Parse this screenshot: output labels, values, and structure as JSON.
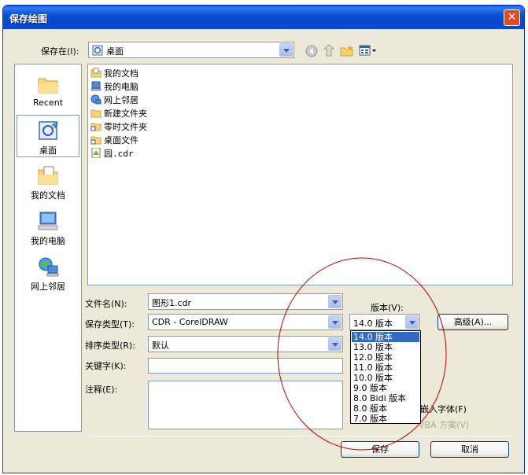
{
  "window": {
    "title": "保存绘图",
    "close_label": "✕"
  },
  "save_in": {
    "label": "保存在(I):",
    "value": "桌面"
  },
  "places": [
    {
      "label": "Recent",
      "icon": "recent-folder-icon"
    },
    {
      "label": "桌面",
      "icon": "desktop-icon",
      "selected": true
    },
    {
      "label": "我的文档",
      "icon": "my-documents-icon"
    },
    {
      "label": "我的电脑",
      "icon": "my-computer-icon"
    },
    {
      "label": "网上邻居",
      "icon": "network-places-icon"
    }
  ],
  "files": [
    {
      "name": "我的文档",
      "icon": "my-documents-icon"
    },
    {
      "name": "我的电脑",
      "icon": "my-computer-icon"
    },
    {
      "name": "网上邻居",
      "icon": "network-places-icon"
    },
    {
      "name": "新建文件夹",
      "icon": "folder-icon"
    },
    {
      "name": "零时文件夹",
      "icon": "shortcut-folder-icon"
    },
    {
      "name": "桌面文件",
      "icon": "shortcut-folder-icon"
    },
    {
      "name": "园.cdr",
      "icon": "cdr-file-icon"
    }
  ],
  "form": {
    "filename_label": "文件名(N):",
    "filename_value": "图形1.cdr",
    "filetype_label": "保存类型(T):",
    "filetype_value": "CDR - CorelDRAW",
    "sort_label": "排序类型(R):",
    "sort_value": "默认",
    "keywords_label": "关键字(K):",
    "notes_label": "注释(E):"
  },
  "version": {
    "label": "版本(V):",
    "value": "14.0 版本",
    "options": [
      "14.0 版本",
      "13.0 版本",
      "12.0 版本",
      "11.0 版本",
      "10.0 版本",
      "9.0 版本",
      "8.0 Bidi 版本",
      "8.0 版本",
      "7.0 版本"
    ]
  },
  "advanced_label": "高级(A)...",
  "embed_fonts_label": "嵌入字体(F)",
  "vba_label": "VBA 方案(V)",
  "save_label": "保存",
  "cancel_label": "取消",
  "colors": {
    "titlebar": "#0a4fd6",
    "selection": "#316ac5",
    "annotation_circle": "#c00000"
  }
}
